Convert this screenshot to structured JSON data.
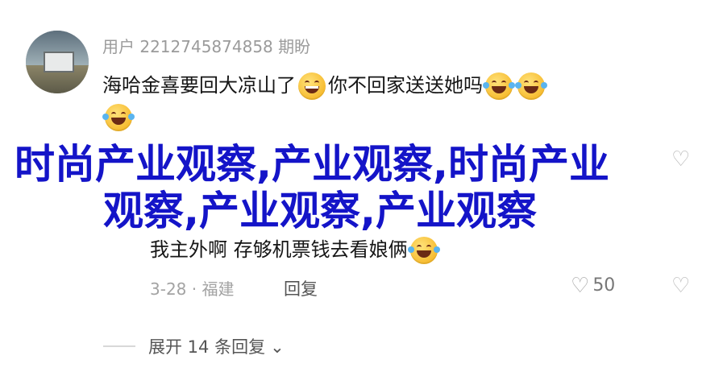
{
  "comment": {
    "username": "用户 2212745874858 期盼",
    "text_line1": "海哈金喜要回大凉山了",
    "text_line1b": "你不回家送送她吗"
  },
  "overlay": {
    "line1": "时尚产业观察,产业观察,时尚产业",
    "line2": "观察,产业观察,产业观察"
  },
  "reply": {
    "text": "我主外啊 存够机票钱去看娘俩",
    "date_location": "3-28 · 福建",
    "reply_label": "回复",
    "like_count": "50"
  },
  "expand": {
    "label": "展开 14 条回复"
  },
  "icons": {
    "avatar": "avatar-image",
    "grin": "grinning-emoji",
    "laugh": "tears-of-joy-emoji",
    "like": "heart-outline-icon",
    "dislike": "broken-heart-icon",
    "chevron": "chevron-down-icon"
  }
}
